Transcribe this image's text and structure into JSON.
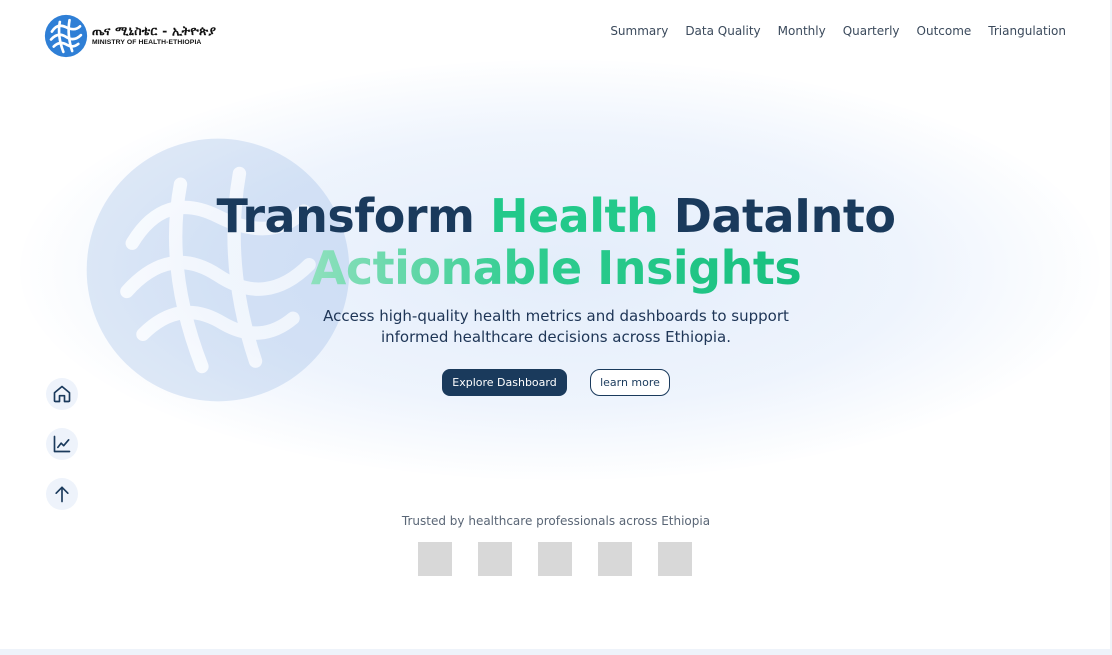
{
  "header": {
    "logo_amharic": "ጤና ሚኒስቴር - ኢትዮጵያ",
    "logo_english": "MINISTRY OF HEALTH-ETHIOPIA",
    "nav": [
      "Summary",
      "Data Quality",
      "Monthly",
      "Quarterly",
      "Outcome",
      "Triangulation"
    ]
  },
  "hero": {
    "headline_part1": "Transform ",
    "headline_part2": "Health",
    "headline_part3": " DataInto",
    "headline_line2": "Actionable Insights",
    "subtitle": "Access high-quality health metrics and dashboards to support informed healthcare decisions across Ethiopia.",
    "primary_button": "Explore Dashboard",
    "secondary_button": "learn more"
  },
  "sidebar": {
    "icons": [
      "home-icon",
      "chart-line-icon",
      "arrow-up-icon"
    ]
  },
  "trusted": {
    "text": "Trusted by healthcare professionals across Ethiopia",
    "partner_count": 5
  },
  "colors": {
    "primary": "#1a3a5c",
    "accent": "#22c98a",
    "placeholder": "#d8d8d8"
  }
}
